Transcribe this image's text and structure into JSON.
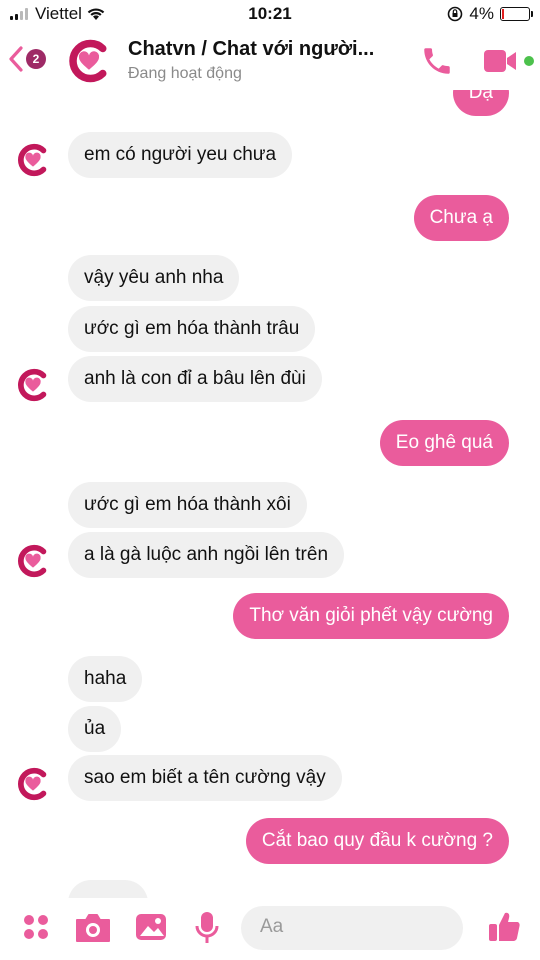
{
  "status_bar": {
    "carrier": "Viettel",
    "time": "10:21",
    "battery": "4%",
    "battery_level": 0.04
  },
  "header": {
    "back_badge": "2",
    "title": "Chatvn / Chat với người...",
    "subtitle": "Đang hoạt động",
    "brand_color": "#ea5c9c",
    "avatar_letter_color": "#c2185b"
  },
  "messages": [
    {
      "direction": "out",
      "text": "Dạ"
    },
    {
      "direction": "in",
      "text": "em có người yeu chưa"
    },
    {
      "direction": "out",
      "text": "Chưa ạ"
    },
    {
      "direction": "in",
      "text": "vậy yêu anh nha"
    },
    {
      "direction": "in",
      "text": "ước gì em hóa thành trâu"
    },
    {
      "direction": "in",
      "text": "anh là con đỉ a bâu lên đùi"
    },
    {
      "direction": "out",
      "text": "Eo ghê quá"
    },
    {
      "direction": "in",
      "text": "ước gì em hóa thành xôi"
    },
    {
      "direction": "in",
      "text": "a là gà luộc anh ngồi lên trên"
    },
    {
      "direction": "out",
      "text": "Thơ văn giỏi phết vậy cường"
    },
    {
      "direction": "in",
      "text": "haha"
    },
    {
      "direction": "in",
      "text": "ủa"
    },
    {
      "direction": "in",
      "text": "sao em biết a tên cường vậy"
    },
    {
      "direction": "out",
      "text": "Cắt bao quy đầu k cường ?"
    }
  ],
  "composer": {
    "placeholder": "Aa",
    "icons": [
      "apps-icon",
      "camera-icon",
      "gallery-icon",
      "microphone-icon",
      "emoji-icon",
      "thumbs-up-icon"
    ]
  }
}
